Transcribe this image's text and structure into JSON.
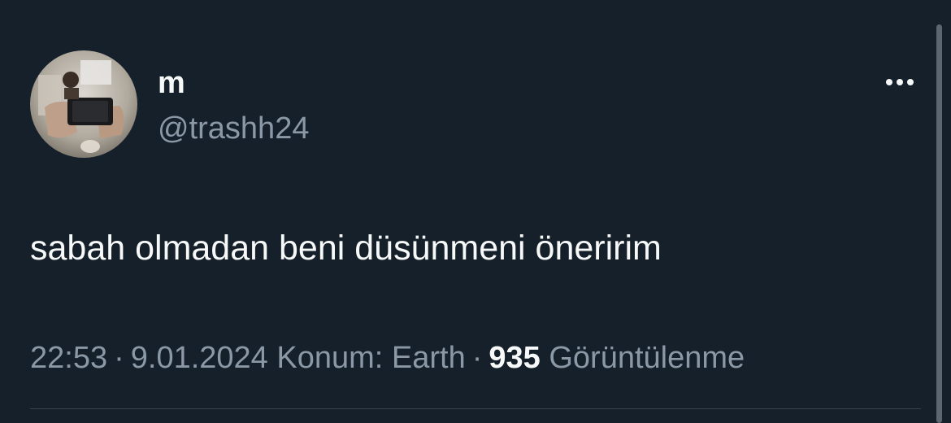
{
  "tweet": {
    "display_name": "m",
    "handle": "@trashh24",
    "text": "sabah olmadan beni düsünmeni öneririm",
    "time": "22:53",
    "date": "9.01.2024",
    "location": "Konum: Earth",
    "views_count": "935",
    "views_label": "Görüntülenme",
    "separator": "·"
  },
  "icons": {
    "more": "more-horizontal-icon",
    "avatar": "avatar-image"
  },
  "colors": {
    "background": "#15202b",
    "primary_text": "#f7f9f9",
    "secondary_text": "#8b98a5",
    "divider": "#38444d"
  }
}
